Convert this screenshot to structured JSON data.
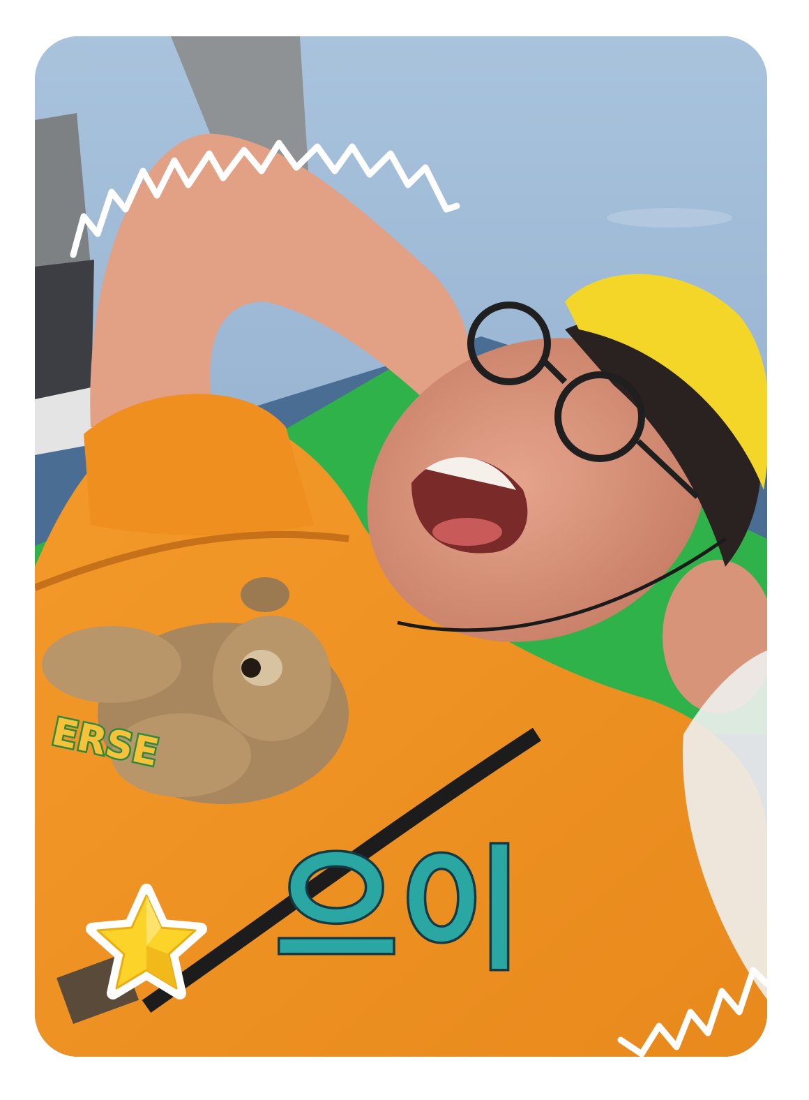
{
  "caption": {
    "text": "으이!"
  },
  "shirt_print": {
    "text": "ERSE"
  },
  "colors": {
    "sky": "#8fb0cf",
    "shirt": "#f39a2a",
    "hat": "#f4d629",
    "mat": "#2fb24a",
    "caption_fill": "#2aa7a3",
    "caption_outline": "#123a45",
    "star": "#fbd329"
  },
  "icons": {
    "corner_badge": "star-icon"
  }
}
